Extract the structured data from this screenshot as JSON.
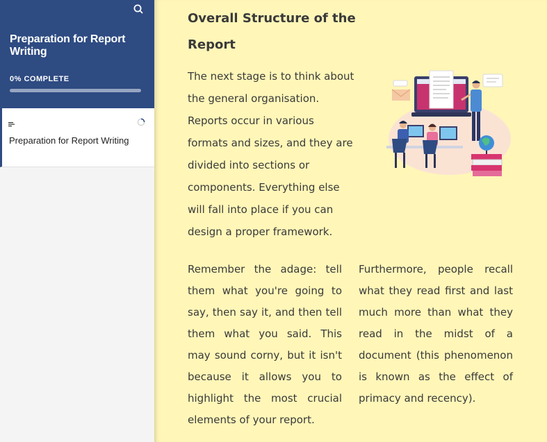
{
  "sidebar": {
    "course_title": "Preparation for Report Writing",
    "progress_label": "0% COMPLETE",
    "progress_value": 0,
    "search_icon": "search-icon",
    "lessons": [
      {
        "label": "Preparation for Report Writing",
        "icon": "text-lines-icon",
        "status_icon": "progress-ring-icon"
      }
    ]
  },
  "main": {
    "heading": "Overall Structure of the Report",
    "intro": "The next stage is to think about the general organisation. Reports occur in various formats and sizes, and they are divided into sections or components. Everything else will fall into place if you can design a proper framework.",
    "paragraph_left": "Remember the adage: tell them what you're going to say, then say it, and then tell them what you said. This may sound corny, but it isn't because it allows you to highlight the most crucial elements of your report.",
    "paragraph_right": "Furthermore, people recall what they read first and last much more than what they read in the midst of a document (this phenomenon is known as the effect of primacy and recency)."
  },
  "colors": {
    "sidebar_header": "#2e4b82",
    "main_background": "#fff6b8",
    "text": "#3a3a3a"
  }
}
